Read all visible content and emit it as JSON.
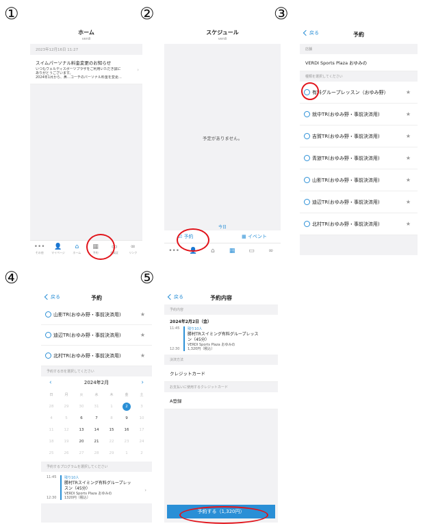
{
  "steps": [
    "①",
    "②",
    "③",
    "④",
    "⑤"
  ],
  "screen1": {
    "title": "ホーム",
    "subtitle": "verdi",
    "date": "2023年12月16日 11:27",
    "notice_title": "スイムパーソナル料金変更のお知らせ",
    "notice_body_1": "いつもヴェルディスポーツプラザをご利用いただき誠に",
    "notice_body_2": "ありがとうございます。",
    "notice_body_3": "2024年1月から、鼻…コーチのパーソナル料金を変更…",
    "tabs": [
      {
        "icon": "•••",
        "label": "その他"
      },
      {
        "icon": "👤",
        "label": "マイページ"
      },
      {
        "icon": "⌂",
        "label": "ホーム"
      },
      {
        "icon": "▦",
        "label": "予約"
      },
      {
        "icon": "▭",
        "label": "会員証"
      },
      {
        "icon": "∞",
        "label": "リンク"
      }
    ]
  },
  "screen2": {
    "title": "スケジュール",
    "subtitle": "verdi",
    "empty": "予定がありません。",
    "today": "今日",
    "reserve": "予約",
    "event": "イベント"
  },
  "screen3": {
    "back": "戻る",
    "title": "予約",
    "store_header": "店舗",
    "store": "VERDI Sports Plaza おゆみの",
    "select_header": "種類を選択してください",
    "items": [
      "有料グループレッスン（おゆみ野）",
      "就中TR(おゆみ野・事前決済用)",
      "吉賀TR(おゆみ野・事前決済用)",
      "青旅TR(おゆみ野・事前決済用)",
      "山影TR(おゆみ野・事前決済用)",
      "迪辺TR(おゆみ野・事前決済用)",
      "北村TR(おゆみ野・事前決済用)"
    ]
  },
  "screen4": {
    "back": "戻る",
    "title": "予約",
    "items": [
      "山影TR(おゆみ野・事前決済用)",
      "迪辺TR(おゆみ野・事前決済用)",
      "北村TR(おゆみ野・事前決済用)"
    ],
    "date_header": "予約する日を選択してください",
    "month": "2024年2月",
    "weekdays": [
      "日",
      "月",
      "火",
      "水",
      "木",
      "金",
      "土"
    ],
    "days": [
      "28",
      "29",
      "30",
      "31",
      "1",
      "2",
      "3",
      "4",
      "5",
      "6",
      "7",
      "8",
      "9",
      "10",
      "11",
      "12",
      "13",
      "14",
      "15",
      "16",
      "17",
      "18",
      "19",
      "20",
      "21",
      "22",
      "23",
      "24",
      "25",
      "26",
      "27",
      "28",
      "29",
      "1",
      "2"
    ],
    "program_header": "予約するプログラムを選択してください",
    "lesson": {
      "start": "11:45",
      "end": "12:30",
      "remaining": "残り10人",
      "name_1": "勝村TRスイミング有料グループレッ",
      "name_2": "スン（45分）",
      "place": "VERDI Sports Plaza おゆみの",
      "price": "1320円（税込）"
    }
  },
  "screen5": {
    "back": "戻る",
    "title": "予約内容",
    "schedule_header": "予約内容",
    "date": "2024年2月2日（金）",
    "start": "11:45",
    "end": "12:30",
    "remaining": "残り10人",
    "name_1": "勝村TRスイミング有料グループレッス",
    "name_2": "ン（45分）",
    "place": "VERDI Sports Plaza おゆみの",
    "price": "1,320円（税込）",
    "payment_header": "決済方法",
    "payment": "クレジットカード",
    "card_header": "お支払いに使用するクレジットカード",
    "card": "A登録",
    "pay_button": "予約する（1,320円）"
  }
}
